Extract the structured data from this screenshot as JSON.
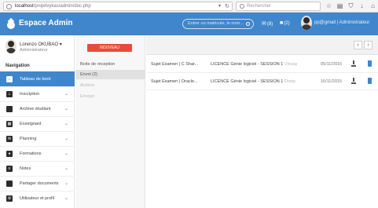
{
  "browser": {
    "url_host": "localhost",
    "url_path": "/projetvykas/admin/doc.php",
    "search_placeholder": "Rechercher"
  },
  "header": {
    "title": "Espace Admin",
    "search_placeholder": "Entrer un matricule, le nom...",
    "messages_badge": "(8)",
    "folders_badge": "(2)",
    "user_label": "pp@gmail | Administrateur"
  },
  "sidebar": {
    "profile_name": "Lorenzo OKUBAO ▾",
    "profile_role": "Administrateur",
    "nav_heading": "Navigation",
    "items": [
      {
        "label": "Tableau de bord",
        "icon": "dashboard-icon",
        "active": true
      },
      {
        "label": "Inscription",
        "icon": "home-icon"
      },
      {
        "label": "Archive étudiant",
        "icon": "file-icon"
      },
      {
        "label": "Enseignant",
        "icon": "grid-icon"
      },
      {
        "label": "Planning",
        "icon": "envelope-icon"
      },
      {
        "label": "Formations",
        "icon": "map-marker-icon"
      },
      {
        "label": "Notes",
        "icon": "list-icon"
      },
      {
        "label": "Partager documents",
        "icon": "document-icon"
      },
      {
        "label": "Utilisateur et profil",
        "icon": "users-cog-icon"
      }
    ]
  },
  "mailbox": {
    "compose_label": "NOUVEAU",
    "folders": [
      {
        "label": "Boite de réception",
        "state": "normal"
      },
      {
        "label": "Envoi (2)",
        "state": "selected"
      },
      {
        "label": "Archive",
        "state": "muted"
      },
      {
        "label": "Envoyé",
        "state": "muted"
      }
    ],
    "pager_prev": "‹",
    "pager_next": "›",
    "messages": [
      {
        "subject": "Sujet Examen | C Shar...",
        "course": "LICENCE Génie logiciel - SESSION 1",
        "sender": "Vinsay",
        "date": "05/11/2015"
      },
      {
        "subject": "Sujet Examen | Oracle...",
        "course": "LICENCE Génie logiciel - SESSION 1",
        "sender": "Dosty",
        "date": "16/11/2015"
      }
    ]
  },
  "colors": {
    "brand_blue": "#3f86cc",
    "compose_red": "#e94a3b"
  }
}
